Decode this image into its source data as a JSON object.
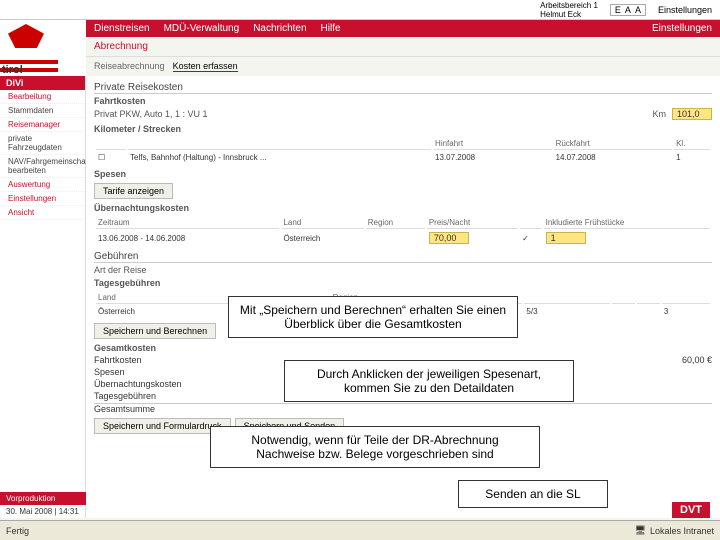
{
  "topbar": {
    "workarea_l1": "Arbeitsbereich 1",
    "workarea_l2": "Helmut Eck",
    "acc": [
      "E",
      "A",
      "A"
    ],
    "settings": "Einstellungen"
  },
  "nav": {
    "items": [
      "Dienstreisen",
      "MDÜ-Verwaltung",
      "Nachrichten",
      "Hilfe"
    ],
    "settings": "Einstellungen"
  },
  "logo": "tirol",
  "breadcrumb": {
    "root": "Abrechnung",
    "path": [
      "Reiseabrechnung",
      "Kosten erfassen"
    ]
  },
  "sidebar": {
    "header": "DiVi",
    "items": [
      {
        "label": "Bearbeitung",
        "red": true
      },
      {
        "label": "Stammdaten",
        "red": false
      },
      {
        "label": "Reisemanager",
        "red": true
      },
      {
        "label": "private Fahrzeugdaten",
        "red": false
      },
      {
        "label": "NAV/Fahrgemeinschaft bearbeiten",
        "red": false
      },
      {
        "label": "Auswertung",
        "red": true
      },
      {
        "label": "Einstellungen",
        "red": true
      },
      {
        "label": "Ansicht",
        "red": true
      }
    ]
  },
  "content": {
    "section1": "Private Reisekosten",
    "subsection1": "Fahrtkosten",
    "car_label": "Privat PKW, Auto 1, 1 : VU 1",
    "km_label": "Km",
    "km_value": "101,0",
    "strecken": "Kilometer / Strecken",
    "strecke_cols": [
      "",
      "",
      "Hinfahrt",
      "Rückfahrt",
      "Kl."
    ],
    "strecke_row": [
      "☐",
      "Telfs, Bahnhof (Haltung) - Innsbruck ...",
      "13.07.2008",
      "14.07.2008",
      "1"
    ],
    "spesen": "Spesen",
    "spesen_btn": "Tarife anzeigen",
    "ueber": "Übernachtungskosten",
    "ueber_cols": [
      "Zeitraum",
      "Land",
      "Region",
      "Preis/Nacht",
      "",
      "Inkludierte Frühstücke"
    ],
    "ueber_row": [
      "13.06.2008 - 14.06.2008",
      "Österreich",
      "",
      "70,00",
      "✓",
      "1"
    ],
    "geb": "Gebühren",
    "art": "Art der Reise",
    "tages": "Tagesgebühren",
    "tages_cols": [
      "Land",
      "Region",
      "",
      "",
      "",
      "",
      "",
      ""
    ],
    "tages_row": [
      "Österreich",
      "",
      "",
      "5/3",
      "",
      "",
      "3",
      ""
    ],
    "buttons": {
      "calc": "Speichern und Berechnen",
      "print": "Speichern und Formulardruck",
      "send": "Speichern und Senden"
    },
    "summary": {
      "title": "Gesamtkosten",
      "rows": [
        "Fahrtkosten",
        "Spesen",
        "Übernachtungskosten",
        "Tagesgebühren"
      ],
      "total": "Gesamtsumme",
      "val": "60,00 €"
    }
  },
  "callouts": {
    "c1": "Mit „Speichern und Berechnen“ erhalten Sie einen Überblick über die Gesamtkosten",
    "c2": "Durch Anklicken der jeweiligen Spesenart, kommen Sie zu den Detaildaten",
    "c3": "Notwendig, wenn für Teile der DR-Abrechnung Nachweise bzw. Belege vorgeschrieben sind",
    "c4": "Senden an die SL"
  },
  "footer": {
    "vp": "Vorproduktion",
    "date": "30. Mai 2008 | 14:31",
    "dvt": "DVT"
  },
  "status": {
    "left": "Fertig",
    "right": "Lokales Intranet"
  }
}
